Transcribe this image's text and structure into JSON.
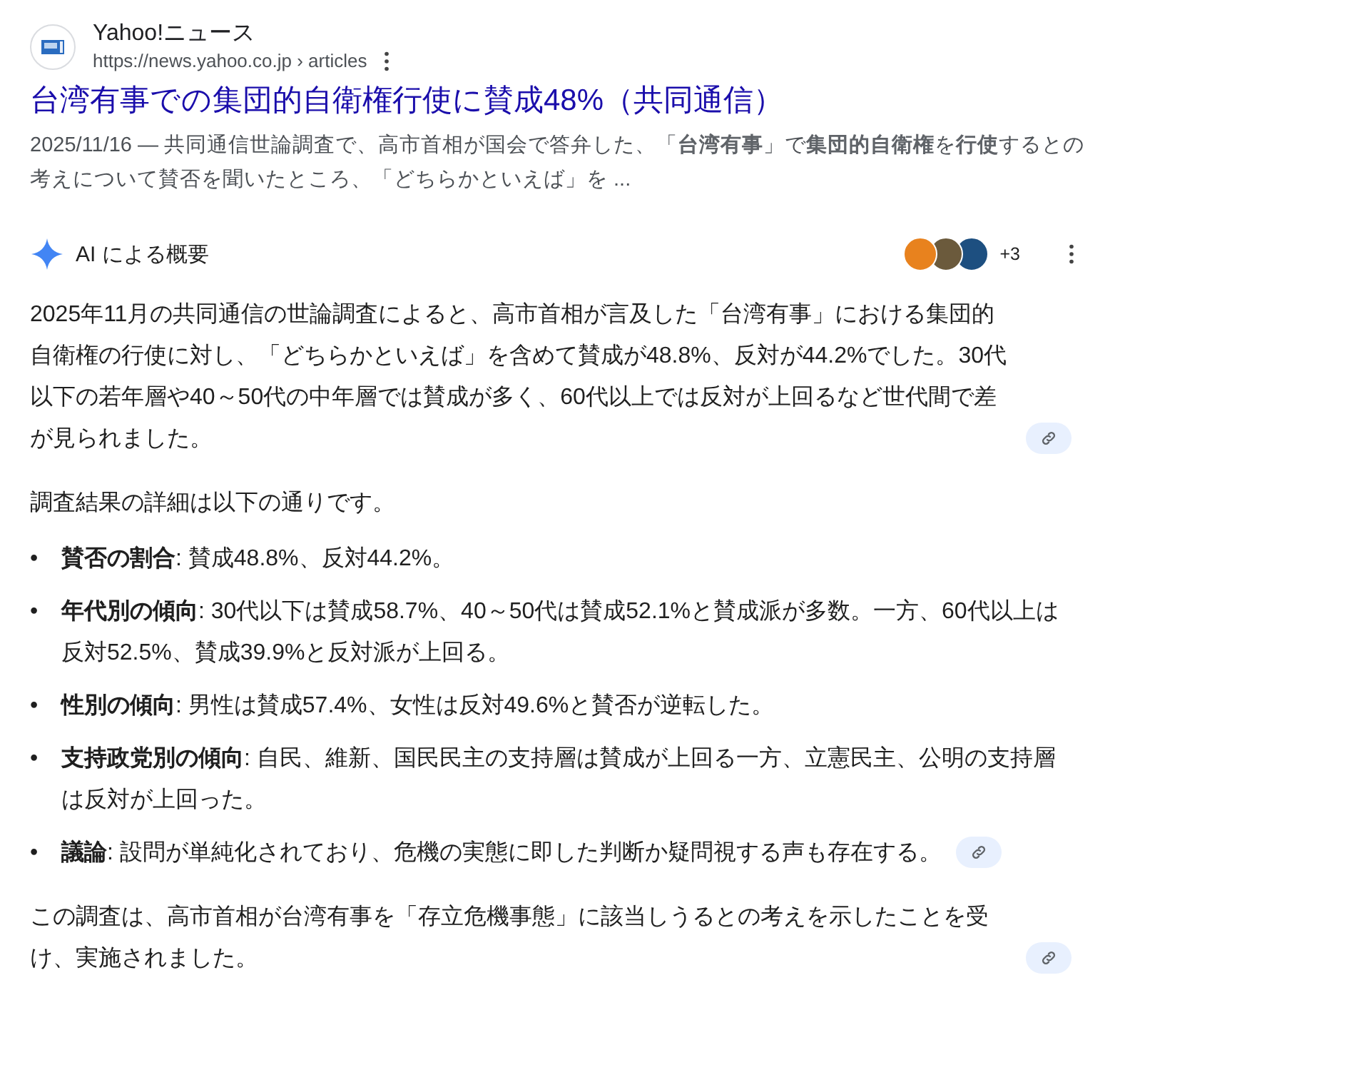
{
  "result": {
    "site_name": "Yahoo!ニュース",
    "url": "https://news.yahoo.co.jp › articles",
    "title": "台湾有事での集団的自衛権行使に賛成48%（共同通信）",
    "snippet": "2025/11/16 — 共同通信世論調査で、高市首相が国会で答弁した、「**台湾有事**」で**集団的自衛権**を**行使**するとの考えについて賛否を聞いたところ、「どちらかといえば」を ..."
  },
  "ai_overview": {
    "heading": "AI による概要",
    "sources": [
      {
        "color": "#e8821e"
      },
      {
        "color": "#6b5a3c"
      },
      {
        "color": "#1d4f80"
      }
    ],
    "more_sources": "+3",
    "blocks": [
      {
        "kind": "paragraph",
        "text": "2025年11月の共同通信の世論調査によると、高市首相が言及した「台湾有事」における集団的自衛権の行使に対し、「どちらかといえば」を含めて賛成が48.8%、反対が44.2%でした。30代以下の若年層や40～50代の中年層では賛成が多く、60代以上では反対が上回るなど世代間で差が見られました。",
        "link": true
      },
      {
        "kind": "paragraph",
        "text": "調査結果の詳細は以下の通りです。",
        "link": false
      },
      {
        "kind": "list",
        "bullet": "•",
        "items": [
          {
            "text": "**賛否の割合**: 賛成48.8%、反対44.2%。",
            "link": false
          },
          {
            "text": "**年代別の傾向**: 30代以下は賛成58.7%、40～50代は賛成52.1%と賛成派が多数。一方、60代以上は反対52.5%、賛成39.9%と反対派が上回る。",
            "link": false
          },
          {
            "text": "**性別の傾向**: 男性は賛成57.4%、女性は反対49.6%と賛否が逆転した。",
            "link": false
          },
          {
            "text": "**支持政党別の傾向**: 自民、維新、国民民主の支持層は賛成が上回る一方、立憲民主、公明の支持層は反対が上回った。",
            "link": false
          },
          {
            "text": "**議論**: 設問が単純化されており、危機の実態に即した判断か疑問視する声も存在する。",
            "link": true
          }
        ]
      },
      {
        "kind": "paragraph",
        "text": "この調査は、高市首相が台湾有事を「存立危機事態」に該当しうるとの考えを示したことを受け、実施されました。",
        "link": true
      }
    ]
  }
}
